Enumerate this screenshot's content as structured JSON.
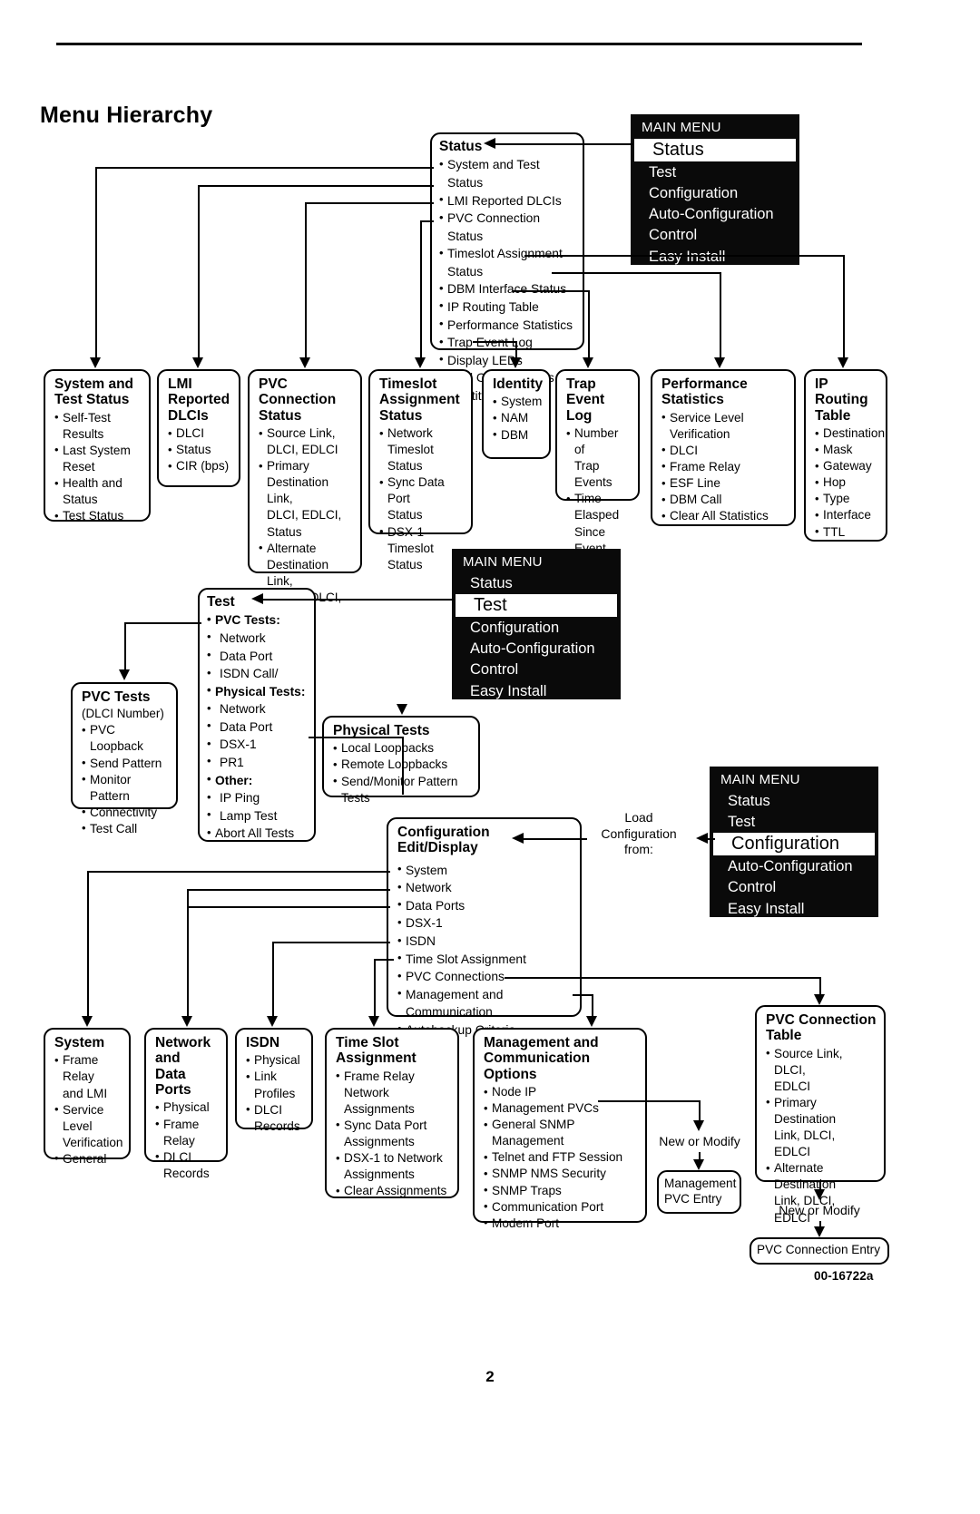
{
  "page": {
    "title": "Menu Hierarchy",
    "number": "2",
    "doc_id": "00-16722a"
  },
  "main_menus": [
    {
      "name": "main-menu-status",
      "title": "MAIN MENU",
      "selected": "Status",
      "items": [
        "Status",
        "Test",
        "Configuration",
        "Auto-Configuration",
        "Control",
        "Easy Install"
      ]
    },
    {
      "name": "main-menu-test",
      "title": "MAIN MENU",
      "selected": "Test",
      "items": [
        "Status",
        "Test",
        "Configuration",
        "Auto-Configuration",
        "Control",
        "Easy Install"
      ]
    },
    {
      "name": "main-menu-configuration",
      "title": "MAIN MENU",
      "selected": "Configuration",
      "items": [
        "Status",
        "Test",
        "Configuration",
        "Auto-Configuration",
        "Control",
        "Easy Install"
      ]
    }
  ],
  "status_branch": {
    "header": "Status",
    "items": [
      "System and Test Status",
      "LMI Reported DLCIs",
      "PVC Connection Status",
      "Timeslot Assignment Status",
      "DBM Interface Status",
      "IP Routing Table",
      "Performance Statistics",
      "Trap Event Log",
      "Display LEDs",
      "and Control Leads",
      "Identity"
    ]
  },
  "status_boxes": [
    {
      "header": "System and\nTest Status",
      "items": [
        "Self-Test Results",
        "Last System\nReset",
        "Health and\nStatus",
        "Test Status"
      ]
    },
    {
      "header": "LMI\nReported\nDLCIs",
      "items": [
        "DLCI",
        "Status",
        "CIR (bps)"
      ]
    },
    {
      "header": "PVC Connection\nStatus",
      "items": [
        "Source Link,\nDLCI, EDLCI",
        "Primary\nDestination Link,\nDLCI, EDLCI,\nStatus",
        "Alternate\nDestination Link,\nDLCI, EDLCI,\nStatus"
      ]
    },
    {
      "header": "Timeslot\nAssignment\nStatus",
      "items": [
        "Network Timeslot\nStatus",
        "Sync Data Port\nStatus",
        "DSX-1 Timeslot\nStatus"
      ]
    },
    {
      "header": "Identity",
      "items": [
        "System",
        "NAM",
        "DBM"
      ]
    },
    {
      "header": "Trap Event\nLog",
      "items": [
        "Number of\nTrap Events",
        "Time Elasped\nSince Event",
        "Event"
      ]
    },
    {
      "header": "Performance\nStatistics",
      "items": [
        "Service Level Verification",
        "DLCI",
        "Frame Relay",
        "ESF Line",
        "DBM Call",
        "Clear All Statistics"
      ]
    },
    {
      "header": "IP Routing\nTable",
      "items": [
        "Destination",
        "Mask",
        "Gateway",
        "Hop",
        "Type",
        "Interface",
        "TTL"
      ]
    }
  ],
  "test_branch": {
    "header": "Test",
    "items": [
      {
        "label": "PVC Tests:",
        "bold": true,
        "indent": false
      },
      {
        "label": "Network",
        "bold": false,
        "indent": true
      },
      {
        "label": "Data Port",
        "bold": false,
        "indent": true
      },
      {
        "label": "ISDN Call/",
        "bold": false,
        "indent": true
      },
      {
        "label": "Physical Tests:",
        "bold": true,
        "indent": false
      },
      {
        "label": "Network",
        "bold": false,
        "indent": true
      },
      {
        "label": "Data Port",
        "bold": false,
        "indent": true
      },
      {
        "label": "DSX-1",
        "bold": false,
        "indent": true
      },
      {
        "label": "PR1",
        "bold": false,
        "indent": true
      },
      {
        "label": "Other:",
        "bold": true,
        "indent": false
      },
      {
        "label": "IP Ping",
        "bold": false,
        "indent": true
      },
      {
        "label": "Lamp Test",
        "bold": false,
        "indent": true
      },
      {
        "label": "Abort All Tests",
        "bold": false,
        "indent": false
      }
    ]
  },
  "pvc_tests_box": {
    "header": "PVC Tests",
    "sub": "(DLCI Number)",
    "items": [
      "PVC Loopback",
      "Send Pattern",
      "Monitor Pattern",
      "Connectivity",
      "Test Call"
    ]
  },
  "physical_tests_box": {
    "header": "Physical Tests",
    "items": [
      "Local Loopbacks",
      "Remote Loopbacks",
      "Send/Monitor Pattern Tests"
    ]
  },
  "configuration_branch": {
    "header": "Configuration\nEdit/Display",
    "items": [
      "System",
      "Network",
      "Data Ports",
      "DSX-1",
      "ISDN",
      "Time Slot Assignment",
      "PVC Connections",
      "Management and Communication",
      "Autobackup Criteria"
    ]
  },
  "load_config_label": "Load\nConfiguration\nfrom:",
  "config_boxes": [
    {
      "header": "System",
      "items": [
        "Frame Relay\nand LMI",
        "Service\nLevel\nVerification",
        "General"
      ]
    },
    {
      "header": "Network\nand\nData Ports",
      "items": [
        "Physical",
        "Frame Relay",
        "DLCI\nRecords"
      ]
    },
    {
      "header": "ISDN",
      "items": [
        "Physical",
        "Link Profiles",
        "DLCI\nRecords"
      ]
    },
    {
      "header": "Time Slot\nAssignment",
      "items": [
        "Frame Relay Network\nAssignments",
        "Sync Data Port\nAssignments",
        "DSX-1 to Network\nAssignments",
        "Clear Assignments"
      ]
    },
    {
      "header": "Management and\nCommunication Options",
      "items": [
        "Node IP",
        "Management PVCs",
        "General SNMP Management",
        "Telnet and FTP Session",
        "SNMP NMS Security",
        "SNMP Traps",
        "Communication Port",
        "Modem Port"
      ]
    },
    {
      "header": "PVC Connection\nTable",
      "items": [
        "Source Link, DLCI,\nEDLCI",
        "Primary Destination\nLink,  DLCI,\nEDLCI",
        "Alternate Destination\nLink,  DLCI,\nEDLCI"
      ]
    }
  ],
  "leaf_boxes": {
    "management_pvc_entry": "Management\nPVC Entry",
    "pvc_connection_entry": "PVC Connection Entry",
    "new_or_modify_1": "New or Modify",
    "new_or_modify_2": "New or Modify"
  }
}
